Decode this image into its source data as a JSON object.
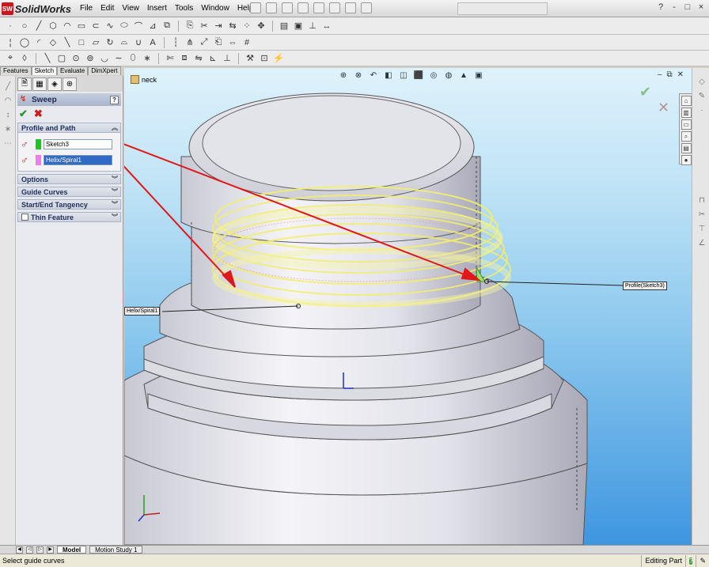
{
  "app": {
    "logo_text": "SolidWorks",
    "logo_mark": "SW",
    "menus": [
      "File",
      "Edit",
      "View",
      "Insert",
      "Tools",
      "Window",
      "Help"
    ],
    "window_controls": [
      "?",
      "-",
      "□",
      "×"
    ]
  },
  "command_tabs": [
    {
      "label": "Features",
      "active": false
    },
    {
      "label": "Sketch",
      "active": true
    },
    {
      "label": "Evaluate",
      "active": false
    },
    {
      "label": "DimXpert",
      "active": false
    }
  ],
  "property_manager": {
    "title": "Sweep",
    "ok_icon": "check-icon",
    "cancel_icon": "x-icon",
    "profile_and_path": {
      "heading": "Profile and Path",
      "profile_value": "Sketch3",
      "profile_color": "#19c819",
      "path_value": "Helix/Spiral1",
      "path_color": "#f07af0"
    },
    "sections": [
      {
        "label": "Options",
        "has_checkbox": false
      },
      {
        "label": "Guide Curves",
        "has_checkbox": false
      },
      {
        "label": "Start/End Tangency",
        "has_checkbox": false
      },
      {
        "label": "Thin Feature",
        "has_checkbox": true
      }
    ]
  },
  "graphics": {
    "tree_node": "neck",
    "callout_profile": "Profile(Sketch3)",
    "callout_path": "Helix/Spiral1",
    "arrow_color": "#e01818",
    "helix_color": "#f2ef6a",
    "background_top": "#dff2fb",
    "background_bottom": "#3e96e0"
  },
  "bottom_tabs": [
    {
      "label": "Model",
      "active": true
    },
    {
      "label": "Motion Study 1",
      "active": false
    }
  ],
  "status": {
    "message": "Select guide curves",
    "mode": "Editing Part"
  }
}
